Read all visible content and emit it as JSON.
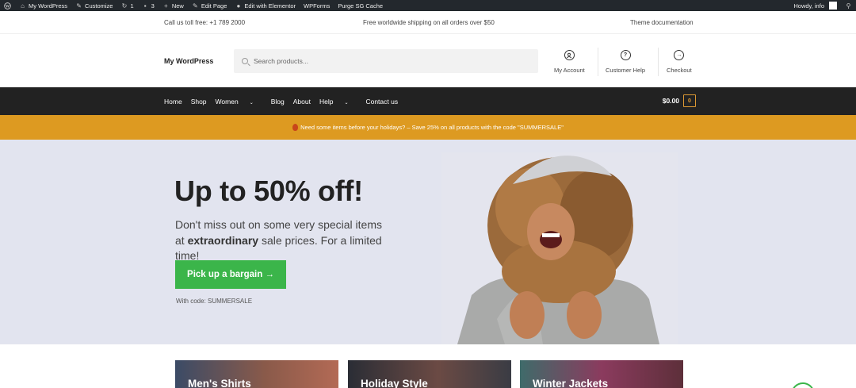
{
  "admin_bar": {
    "items": [
      "My WordPress",
      "Customize",
      "1",
      "3",
      "New",
      "Edit Page",
      "Edit with Elementor",
      "WPForms",
      "Purge SG Cache"
    ],
    "howdy": "Howdy, info"
  },
  "info_bar": {
    "phone": "Call us toll free: +1 789 2000",
    "shipping": "Free worldwide shipping on all orders over $50",
    "docs": "Theme documentation"
  },
  "header": {
    "site_title": "My WordPress",
    "search_placeholder": "Search products...",
    "links": [
      {
        "label": "My Account",
        "icon": "user-icon"
      },
      {
        "label": "Customer Help",
        "icon": "help-icon"
      },
      {
        "label": "Checkout",
        "icon": "arrow-right-circle-icon"
      }
    ]
  },
  "nav": {
    "items": [
      "Home",
      "Shop",
      "Women",
      "Blog",
      "About",
      "Help",
      "Contact us"
    ],
    "cart_total": "$0.00",
    "cart_count": "0"
  },
  "promo": {
    "text": "Need some items before your holidays? – Save 25% on all products with the code \"SUMMERSALE\""
  },
  "hero": {
    "title": "Up to 50% off!",
    "sub_1": "Don't miss out on some very special items at",
    "sub_bold": "extraordinary",
    "sub_2": " sale prices. For a limited time!",
    "cta": "Pick up a bargain →",
    "code": "With code: SUMMERSALE"
  },
  "tiles": [
    "Men's Shirts",
    "Holiday Style",
    "Winter Jackets"
  ],
  "colors": {
    "accent": "#dd9a21",
    "cta_green": "#3bb54a",
    "nav_bg": "#222222",
    "hero_bg": "#e2e4ef"
  }
}
